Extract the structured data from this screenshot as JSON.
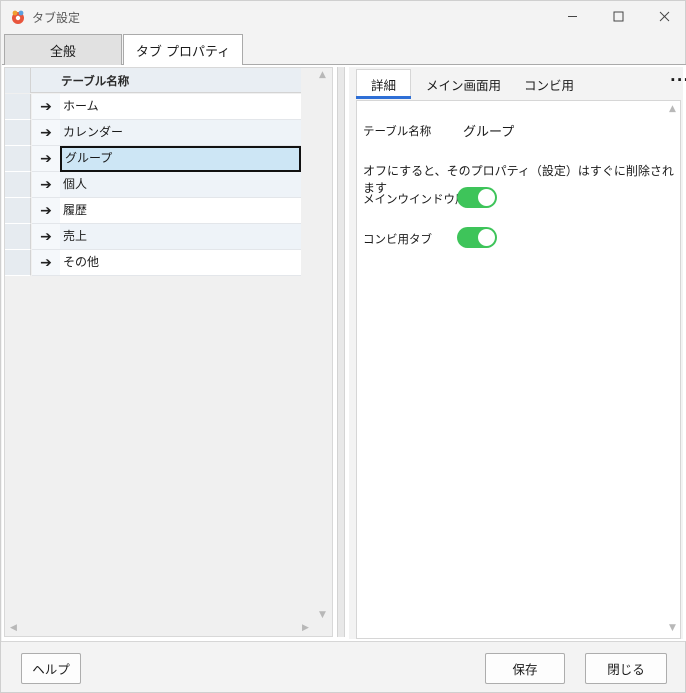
{
  "window": {
    "title": "タブ設定"
  },
  "main_tabs": [
    {
      "label": "全般",
      "selected": false
    },
    {
      "label": "タブ プロパティ",
      "selected": true
    }
  ],
  "grid": {
    "header": "テーブル名称",
    "rows": [
      {
        "name": "ホーム"
      },
      {
        "name": "カレンダー"
      },
      {
        "name": "グループ",
        "selected": true
      },
      {
        "name": "個人"
      },
      {
        "name": "履歴"
      },
      {
        "name": "売上"
      },
      {
        "name": "その他"
      }
    ]
  },
  "sub_tabs": [
    {
      "label": "詳細",
      "selected": true
    },
    {
      "label": "メイン画面用"
    },
    {
      "label": "コンビ用"
    }
  ],
  "detail": {
    "table_name_label": "テーブル名称",
    "table_name_value": "グループ",
    "note": "オフにすると、そのプロパティ（設定）はすぐに削除されます",
    "toggles": [
      {
        "label": "メインウインドウ用",
        "on": true
      },
      {
        "label": "コンビ用タブ",
        "on": true
      }
    ]
  },
  "footer": {
    "help": "ヘルプ",
    "save": "保存",
    "close": "閉じる"
  },
  "colors": {
    "accent": "#2e6fd6",
    "toggle_on": "#3ec45a",
    "selection": "#cde6f5"
  }
}
